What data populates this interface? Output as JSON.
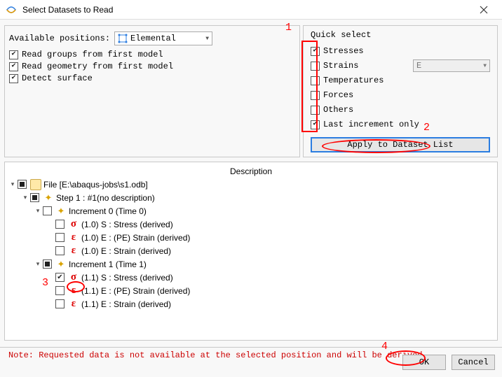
{
  "window": {
    "title": "Select Datasets to Read"
  },
  "left": {
    "positions_label": "Available positions:",
    "positions_value": "Elemental",
    "opts": [
      {
        "label": "Read groups from first model",
        "checked": true
      },
      {
        "label": "Read geometry from first model",
        "checked": true
      },
      {
        "label": "Detect surface",
        "checked": true
      }
    ]
  },
  "quick_select": {
    "title": "Quick select",
    "items": [
      {
        "label": "Stresses",
        "checked": true,
        "has_dd": false
      },
      {
        "label": "Strains",
        "checked": false,
        "has_dd": true,
        "dd_value": "E"
      },
      {
        "label": "Temperatures",
        "checked": false,
        "has_dd": false
      },
      {
        "label": "Forces",
        "checked": false,
        "has_dd": false
      },
      {
        "label": "Others",
        "checked": false,
        "has_dd": false
      },
      {
        "label": "Last increment only",
        "checked": true,
        "has_dd": false
      }
    ],
    "apply_label": "Apply to Dataset List"
  },
  "tree": {
    "header": "Description",
    "rows": [
      {
        "depth": 0,
        "arrow": "down",
        "tristate": "filled",
        "icon": "folder",
        "label": "File [E:\\abaqus-jobs\\s1.odb]"
      },
      {
        "depth": 1,
        "arrow": "down",
        "tristate": "filled",
        "icon": "step",
        "label": "Step 1 : #1(no description)"
      },
      {
        "depth": 2,
        "arrow": "down",
        "tristate": "empty",
        "icon": "step",
        "label": "Increment 0 (Time 0)"
      },
      {
        "depth": 3,
        "arrow": null,
        "tristate": "empty",
        "icon": "sigma",
        "label": "(1.0) S :  Stress (derived)"
      },
      {
        "depth": 3,
        "arrow": null,
        "tristate": "empty",
        "icon": "eps",
        "label": "(1.0) E : (PE) Strain (derived)"
      },
      {
        "depth": 3,
        "arrow": null,
        "tristate": "empty",
        "icon": "eps",
        "label": "(1.0) E :  Strain (derived)"
      },
      {
        "depth": 2,
        "arrow": "down",
        "tristate": "filled",
        "icon": "step",
        "label": "Increment 1 (Time 1)"
      },
      {
        "depth": 3,
        "arrow": null,
        "tristate": "checked",
        "icon": "sigma",
        "label": "(1.1) S :  Stress (derived)"
      },
      {
        "depth": 3,
        "arrow": null,
        "tristate": "empty",
        "icon": "eps",
        "label": "(1.1) E : (PE) Strain (derived)"
      },
      {
        "depth": 3,
        "arrow": null,
        "tristate": "empty",
        "icon": "eps",
        "label": "(1.1) E :  Strain (derived)"
      }
    ]
  },
  "note": "Note: Requested data is not available at the selected position and will be derived",
  "buttons": {
    "ok": "OK",
    "cancel": "Cancel"
  },
  "annotations": {
    "a1": "1",
    "a2": "2",
    "a3": "3",
    "a4": "4"
  }
}
